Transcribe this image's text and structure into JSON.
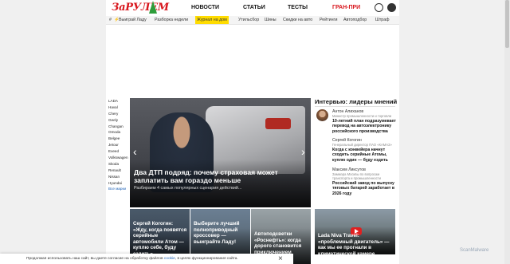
{
  "header": {
    "logo": "ЗаРУЛЕМ",
    "nav": [
      "НОВОСТИ",
      "СТАТЬИ",
      "ТЕСТЫ"
    ],
    "accent_nav": "ГРАН-ПРИ"
  },
  "tags": [
    "#",
    "Выиграй Ладу",
    "Разборка недели",
    "Журнал на дом",
    "Утильсбор",
    "Шины",
    "Скидки на авто",
    "Рейтинги",
    "Автоподбор",
    "Штраф"
  ],
  "brands": [
    "LADA",
    "Haval",
    "Chery",
    "Geely",
    "Changan",
    "Omoda",
    "Belgee",
    "Jetour",
    "Exeed",
    "Volkswagen",
    "Skoda",
    "Renault",
    "Nissan",
    "Hyundai"
  ],
  "brands_more": "Все марки",
  "hero": {
    "title": "Два ДТП подряд: почему страховая может заплатить вам гораздо меньше",
    "subtitle": "Разбираем 4 самых популярных сценария действий..."
  },
  "thumbs": [
    "Сергей Когогин: «Жду, когда появятся серийные автомобили Атом — куплю себе, буду ездить»",
    "Выберите лучший полноприводный кроссовер — выиграйте Ладу!",
    "Автоподсветки «Роснефть»: когда дорого становится приключением"
  ],
  "interview": {
    "title": "Интервью: лидеры мнений",
    "items": [
      {
        "name": "Антон Алиханов",
        "role": "Министр промышленности и торговли",
        "text": "10-летний план подразумевает перевод на автоэлектронику российского производства"
      },
      {
        "name": "Сергей Когогин",
        "role": "Генеральный директор ПАО «КАМАЗ»",
        "text": "Когда с конвейера начнут сходить серийные Атомы, куплю один — буду ездить"
      },
      {
        "name": "Максим Ликсутов",
        "role": "Заммэра Москвы по вопросам транспорта и промышленности",
        "text": "Российский завод по выпуску тяговых батарей заработает в 2026 году"
      }
    ]
  },
  "video": {
    "title": "Lada Niva Travel: «проблемный двигатель» — как мы ее прогнали в климатической камере"
  },
  "cookie": {
    "text": "Продолжая использовать наш сайт, вы даете согласие на обработку файлов ",
    "link": "cookie",
    "text2": ", в целях функционирования сайта."
  },
  "watermark": "ScanMalware"
}
